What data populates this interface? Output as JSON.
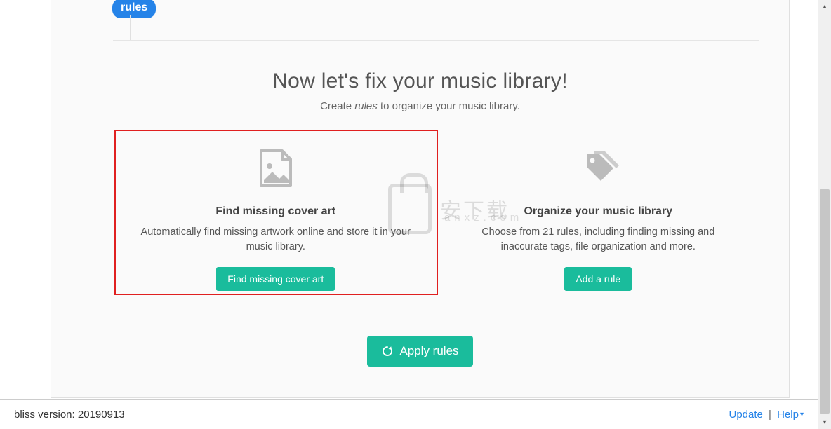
{
  "tab": {
    "label": "rules"
  },
  "hero": {
    "title": "Now let's fix your music library!",
    "subtitle_prefix": "Create ",
    "subtitle_em": "rules",
    "subtitle_suffix": " to organize your music library."
  },
  "cards": {
    "cover_art": {
      "title": "Find missing cover art",
      "desc": "Automatically find missing artwork online and store it in your music library.",
      "button": "Find missing cover art"
    },
    "organize": {
      "title": "Organize your music library",
      "desc": "Choose from 21 rules, including finding missing and inaccurate tags, file organization and more.",
      "button": "Add a rule"
    }
  },
  "apply_button": "Apply rules",
  "footer": {
    "version_label": "bliss version: ",
    "version_value": "20190913",
    "update": "Update",
    "help": "Help"
  },
  "watermark": {
    "main": "安下载",
    "sub": "anxz.com"
  }
}
